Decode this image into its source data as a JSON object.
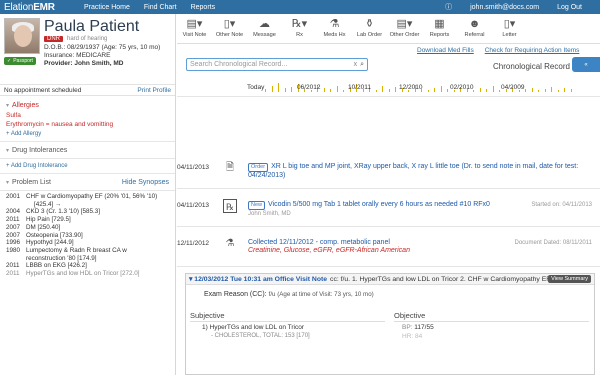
{
  "nav": {
    "brand_prefix": "Elation",
    "brand_suffix": "EMR",
    "links": [
      "Practice Home",
      "Find Chart",
      "Reports"
    ],
    "info_icon": "info-icon",
    "user_email": "john.smith@docs.com",
    "logout": "Log Out",
    "bar_color": "#2f6ea0"
  },
  "patient": {
    "name": "Paula Patient",
    "dnr": "DNR",
    "hearing": "hard of hearing",
    "dob": "D.O.B.: 08/29/1937 (Age: 75 yrs, 10 mo)",
    "insurance": "Insurance:  MEDICARE",
    "provider": "Provider: John Smith, MD",
    "passport": "Passport",
    "appointment": "No appointment scheduled",
    "print_profile": "Print Profile"
  },
  "allergies": {
    "title": "Allergies",
    "items": [
      "Sulfa",
      "Erythromycin = nausea and vomitting"
    ],
    "add": "+ Add Allergy"
  },
  "drug_intolerances": {
    "title": "Drug Intolerances",
    "add": "+ Add Drug Intolerance"
  },
  "problem_list": {
    "title": "Problem List",
    "hide_synopses": "Hide Synopses",
    "items": [
      {
        "year": "2001",
        "text": "CHF w Cardiomyopathy EF (20% '01, 56% '10)",
        "sub": "[425.4] →"
      },
      {
        "year": "2004",
        "text": "CKD 3 (Cr. 1.3 '10) [585.3]",
        "sub": ""
      },
      {
        "year": "2011",
        "text": "Hip Pain [729.5]",
        "sub": ""
      },
      {
        "year": "2007",
        "text": "DM [250.40]",
        "sub": ""
      },
      {
        "year": "2007",
        "text": "Osteopenia [733.90]",
        "sub": ""
      },
      {
        "year": "1996",
        "text": "Hypothyd [244.9]",
        "sub": ""
      },
      {
        "year": "1980",
        "text": "Lumpectomy & Radn R breast CA w reconstruction '80 [174.9]",
        "sub": ""
      },
      {
        "year": "2011",
        "text": "LBBB on EKG [426.2]",
        "sub": ""
      },
      {
        "year": "2011",
        "text": "HyperTGs and low HDL on Tricor [272.0]",
        "sub": ""
      }
    ]
  },
  "toolbar": {
    "items": [
      {
        "label": "Visit Note",
        "icon": "note-icon"
      },
      {
        "label": "Other Note",
        "icon": "note-icon"
      },
      {
        "label": "Message",
        "icon": "message-icon"
      },
      {
        "label": "Rx",
        "icon": "rx-icon"
      },
      {
        "label": "Meds Hx",
        "icon": "meds-icon"
      },
      {
        "label": "Lab Order",
        "icon": "flask-icon"
      },
      {
        "label": "Other Order",
        "icon": "order-icon"
      },
      {
        "label": "Reports",
        "icon": "report-icon"
      },
      {
        "label": "Referral",
        "icon": "person-icon"
      },
      {
        "label": "Letter",
        "icon": "letter-icon"
      }
    ]
  },
  "links": {
    "download_med_fills": "Download Med Fills",
    "check_requiring_action": "Check for Requiring Action Items"
  },
  "search": {
    "placeholder": "Search Chronological Record...",
    "clear": "x"
  },
  "chronological": {
    "title": "Chronological Record",
    "side_tab": "«"
  },
  "timeline": {
    "labels": [
      "Today",
      "06/2012",
      "10/2011",
      "12/2010",
      "02/2010",
      "04/2009"
    ],
    "bar_color": "#d8b400"
  },
  "entries": [
    {
      "date": "04/11/2013",
      "icon": "document-icon",
      "badge": "Order",
      "text": "XR L big toe and MP joint, XRay upper back, X ray L little toe (Dr. to send note in mail, date for test: 04/24/2013)"
    },
    {
      "date": "04/11/2013",
      "icon": "rx-icon",
      "badge": "New",
      "text": "Vicodin 5/500 mg Tab 1 tablet orally every 6 hours as needed #10 RFx0",
      "author": "John Smith, MD",
      "meta": "Started on: 04/11/2013"
    },
    {
      "date": "12/11/2012",
      "icon": "flask-icon",
      "text": "Collected 12/11/2012 - comp. metabolic panel",
      "red": "Creatinine, Glucose, eGFR, eGFR-African American",
      "meta": "Document Dated: 08/11/2011"
    }
  ],
  "visit": {
    "date": "▾ 12/03/2012 Tue 10:31 am Office Visit Note",
    "summary": "cc: f/u. 1. HyperTGs and low LDL on Tricor 2. CHF w Cardiomyopathy EF",
    "view_summary": "View Summary",
    "exam_reason": "Exam Reason (CC):",
    "exam_value": "f/u (Age at time of Visit: 73 yrs, 10 mo)",
    "subjective": "Subjective",
    "objective": "Objective",
    "subj_item": "1)  HyperTGs and low LDL on Tricor",
    "subj_sub": "- CHOLESTEROL, TOTAL: 153  [170]",
    "bp_label": "BP:",
    "bp_value": "117/55",
    "hr_label": "HR:",
    "hr_value": "84"
  }
}
